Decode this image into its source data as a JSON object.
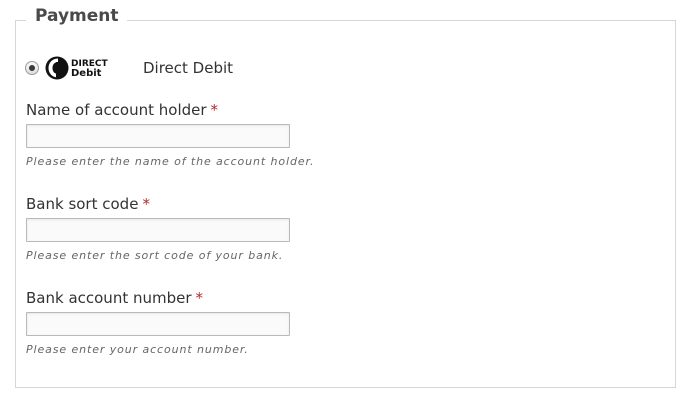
{
  "fieldset": {
    "legend": "Payment"
  },
  "payment_method": {
    "selected": true,
    "logo_text_top": "DIRECT",
    "logo_text_bottom": "Debit",
    "label": "Direct Debit"
  },
  "fields": [
    {
      "label": "Name of account holder",
      "required_marker": "*",
      "value": "",
      "hint": "Please enter the name of the account holder."
    },
    {
      "label": "Bank sort code",
      "required_marker": "*",
      "value": "",
      "hint": "Please enter the sort code of your bank."
    },
    {
      "label": "Bank account number",
      "required_marker": "*",
      "value": "",
      "hint": "Please enter your account number."
    }
  ],
  "colors": {
    "required": "#b5282a",
    "border": "#d6d6d6",
    "hint": "#666666"
  }
}
